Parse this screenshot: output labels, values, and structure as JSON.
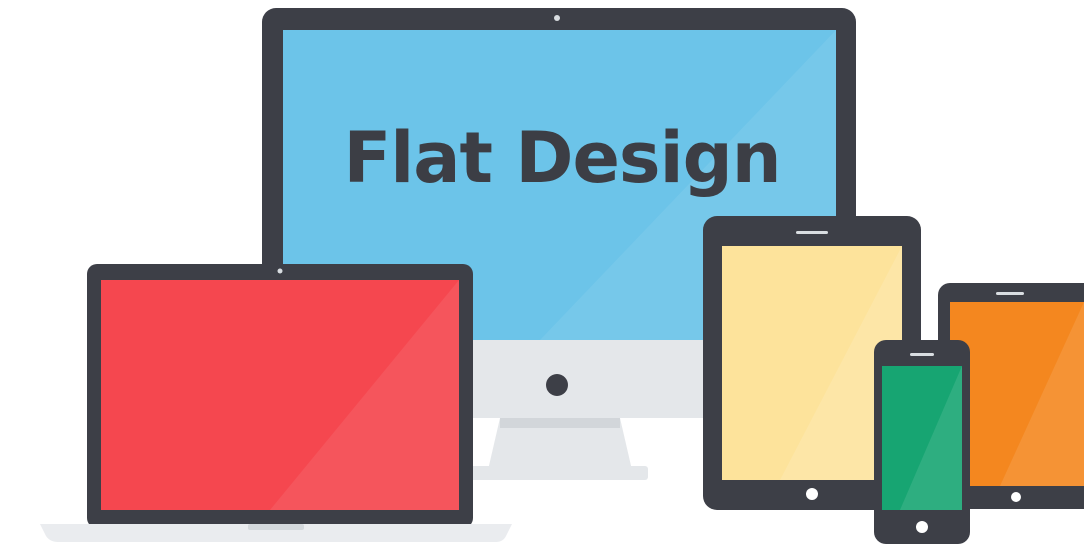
{
  "headline": "Flat Design",
  "devices": {
    "desktop_monitor": {
      "screen_color": "#6cc4e9",
      "icon": "desktop-monitor-icon"
    },
    "laptop": {
      "screen_color": "#f5474f",
      "icon": "laptop-icon"
    },
    "tablet": {
      "screen_color": "#fde39b",
      "icon": "tablet-icon"
    },
    "small_tablet": {
      "screen_color": "#f4871f",
      "icon": "tablet-icon"
    },
    "phone": {
      "screen_color": "#17a572",
      "icon": "smartphone-icon"
    }
  },
  "colors": {
    "device_frame": "#3d3f47",
    "stand": "#e4e7ea",
    "laptop_base": "#eaecef",
    "background": "#ffffff"
  }
}
